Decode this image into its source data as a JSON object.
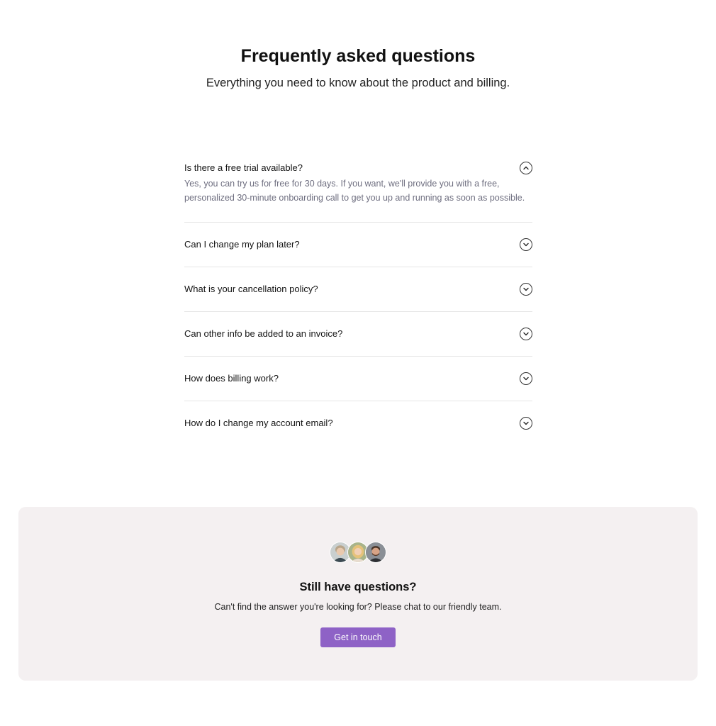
{
  "header": {
    "title": "Frequently asked questions",
    "subtitle": "Everything you need to know about the product and billing."
  },
  "faq": {
    "items": [
      {
        "question": "Is there a free trial available?",
        "answer": "Yes, you can try us for free for 30 days. If you want, we'll provide you with a free, personalized 30-minute onboarding call to get you up and running as soon as possible.",
        "expanded": true,
        "icon": "chevron-up-circle-icon"
      },
      {
        "question": "Can I change my plan later?",
        "expanded": false,
        "icon": "chevron-down-circle-icon"
      },
      {
        "question": "What is your cancellation policy?",
        "expanded": false,
        "icon": "chevron-down-circle-icon"
      },
      {
        "question": "Can other info be added to an invoice?",
        "expanded": false,
        "icon": "chevron-down-circle-icon"
      },
      {
        "question": "How does billing work?",
        "expanded": false,
        "icon": "chevron-down-circle-icon"
      },
      {
        "question": "How do I change my account email?",
        "expanded": false,
        "icon": "chevron-down-circle-icon"
      }
    ]
  },
  "cta": {
    "title": "Still have questions?",
    "text": "Can't find the answer you're looking for? Please chat to our friendly team.",
    "button_label": "Get in touch",
    "avatars": [
      "avatar-1",
      "avatar-2",
      "avatar-3"
    ]
  },
  "colors": {
    "accent": "#8e62c6",
    "cta_background": "#f4f0f1",
    "answer_text": "#6f6f80",
    "divider": "#e6e6e6"
  }
}
